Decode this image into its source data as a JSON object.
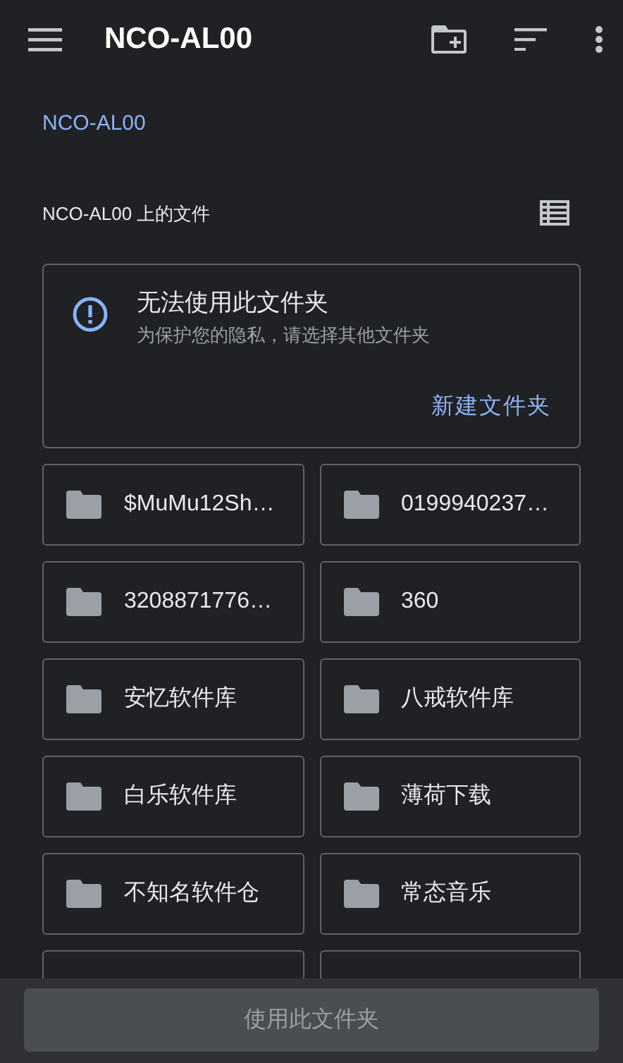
{
  "app_bar": {
    "title": "NCO-AL00"
  },
  "breadcrumb": "NCO-AL00",
  "section": {
    "title": "NCO-AL00 上的文件"
  },
  "notice": {
    "title": "无法使用此文件夹",
    "subtitle": "为保护您的隐私，请选择其他文件夹",
    "action": "新建文件夹"
  },
  "folders": [
    {
      "name": "$MuMu12Sh…"
    },
    {
      "name": "0199940237…"
    },
    {
      "name": "3208871776…"
    },
    {
      "name": "360"
    },
    {
      "name": "安忆软件库"
    },
    {
      "name": "八戒软件库"
    },
    {
      "name": "白乐软件库"
    },
    {
      "name": "薄荷下载"
    },
    {
      "name": "不知名软件仓"
    },
    {
      "name": "常态音乐"
    }
  ],
  "use_button": {
    "label": "使用此文件夹",
    "disabled": true
  }
}
